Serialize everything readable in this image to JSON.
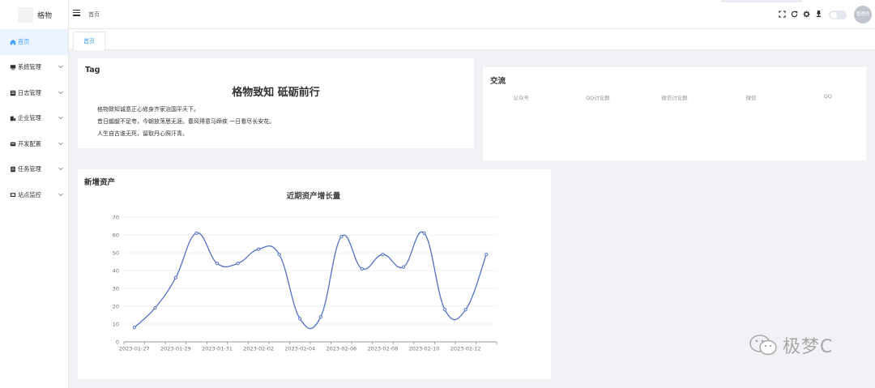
{
  "app": {
    "logo_text": "格物"
  },
  "sidebar": {
    "items": [
      {
        "label": "首页",
        "icon": "home-icon",
        "active": true
      },
      {
        "label": "系统管理",
        "icon": "system-icon"
      },
      {
        "label": "日志管理",
        "icon": "log-icon"
      },
      {
        "label": "企业管理",
        "icon": "enterprise-icon"
      },
      {
        "label": "开发配置",
        "icon": "dev-config-icon"
      },
      {
        "label": "任务管理",
        "icon": "task-icon"
      },
      {
        "label": "站点监控",
        "icon": "monitor-icon"
      }
    ]
  },
  "header": {
    "breadcrumb": "首页",
    "avatar_label": "管理员"
  },
  "tabs": [
    {
      "label": "首页"
    }
  ],
  "tag_card": {
    "title": "Tag",
    "heading": "格物致知 砥砺前行",
    "lines": [
      "格物致知诚意正心修身齐家治国平天下。",
      "昔日龌龊不足夸，今朝放荡思无涯。春风得意马蹄疾 一日看尽长安花。",
      "人生自古谁无死，留取丹心照汗青。"
    ]
  },
  "chat_card": {
    "title": "交流",
    "columns": [
      "公众号",
      "QQ讨论群",
      "微信讨论群",
      "微信",
      "QQ"
    ]
  },
  "asset_card": {
    "title": "新增资产"
  },
  "chart_data": {
    "type": "line",
    "title": "近期资产增长量",
    "x": [
      "2023-01-27",
      "2023-01-28",
      "2023-01-29",
      "2023-01-30",
      "2023-01-31",
      "2023-02-01",
      "2023-02-02",
      "2023-02-03",
      "2023-02-04",
      "2023-02-05",
      "2023-02-06",
      "2023-02-07",
      "2023-02-08",
      "2023-02-09",
      "2023-02-10",
      "2023-02-11",
      "2023-02-12",
      "2023-02-13"
    ],
    "x_tick_labels": [
      "2023-01-27",
      "2023-01-29",
      "2023-01-31",
      "2023-02-02",
      "2023-02-04",
      "2023-02-06",
      "2023-02-08",
      "2023-02-10",
      "2023-02-12"
    ],
    "values": [
      8,
      19,
      36,
      61,
      44,
      44,
      52,
      49,
      13,
      14,
      59,
      41,
      49,
      42,
      61,
      18,
      18,
      49
    ],
    "ylim": [
      0,
      70
    ],
    "y_ticks": [
      0,
      10,
      20,
      30,
      40,
      50,
      60,
      70
    ],
    "grid": true,
    "color": "#5470c6"
  },
  "watermark": {
    "text": "极梦C"
  }
}
